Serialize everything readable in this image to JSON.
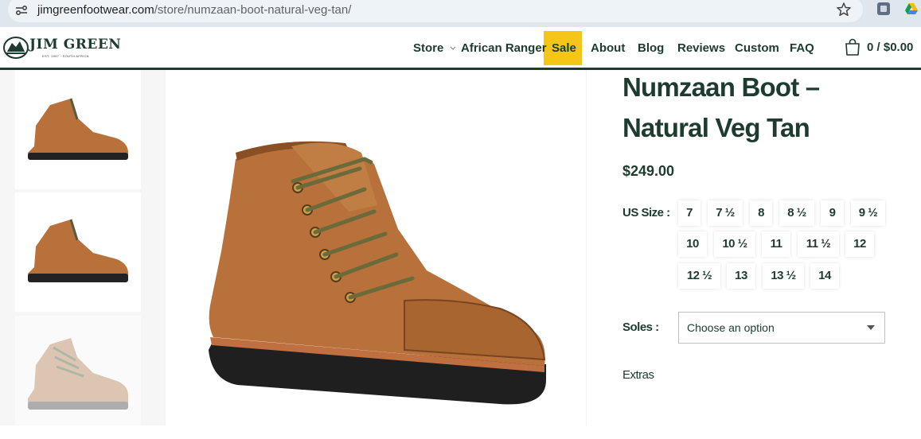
{
  "browser": {
    "url_domain": "jimgreenfootwear.com",
    "url_path": "/store/numzaan-boot-natural-veg-tan/"
  },
  "header": {
    "logo_text": "JIM GREEN",
    "logo_sub": "EST. 1997 · SOUTH AFRICA",
    "nav": [
      {
        "label": "Store"
      },
      {
        "label": "African Ranger"
      },
      {
        "label": "Sale"
      },
      {
        "label": "About"
      },
      {
        "label": "Blog"
      },
      {
        "label": "Reviews"
      },
      {
        "label": "Custom"
      },
      {
        "label": "FAQ"
      }
    ],
    "cart_count": "0",
    "cart_sep": "/",
    "cart_total": "$0.00"
  },
  "product": {
    "title": "Numzaan Boot – Natural Veg Tan",
    "price": "$249.00",
    "size_label": "US Size :",
    "sizes": [
      "7",
      "7 ½",
      "8",
      "8 ½",
      "9",
      "9 ½",
      "10",
      "10 ½",
      "11",
      "11 ½",
      "12",
      "12 ½",
      "13",
      "13 ½",
      "14"
    ],
    "soles_label": "Soles :",
    "soles_value": "Choose an option",
    "extras_label": "Extras"
  },
  "colors": {
    "brand": "#1d3b2f",
    "accent": "#f5c518",
    "leather": "#b8713a"
  }
}
